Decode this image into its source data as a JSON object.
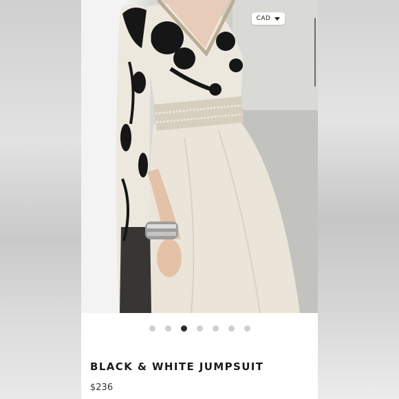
{
  "header": {
    "currency_label": "CAD"
  },
  "carousel": {
    "total_dots": 7,
    "active_index": 2
  },
  "product": {
    "title": "BLACK & WHITE JUMPSUIT",
    "price": "$236"
  },
  "colors": {
    "dress_cream": "#ece7dd",
    "floral_black": "#141414",
    "belt": "#d8d2c4",
    "wall": "#f4f4f4"
  },
  "icons": {
    "currency_caret": "chevron-down-icon"
  }
}
